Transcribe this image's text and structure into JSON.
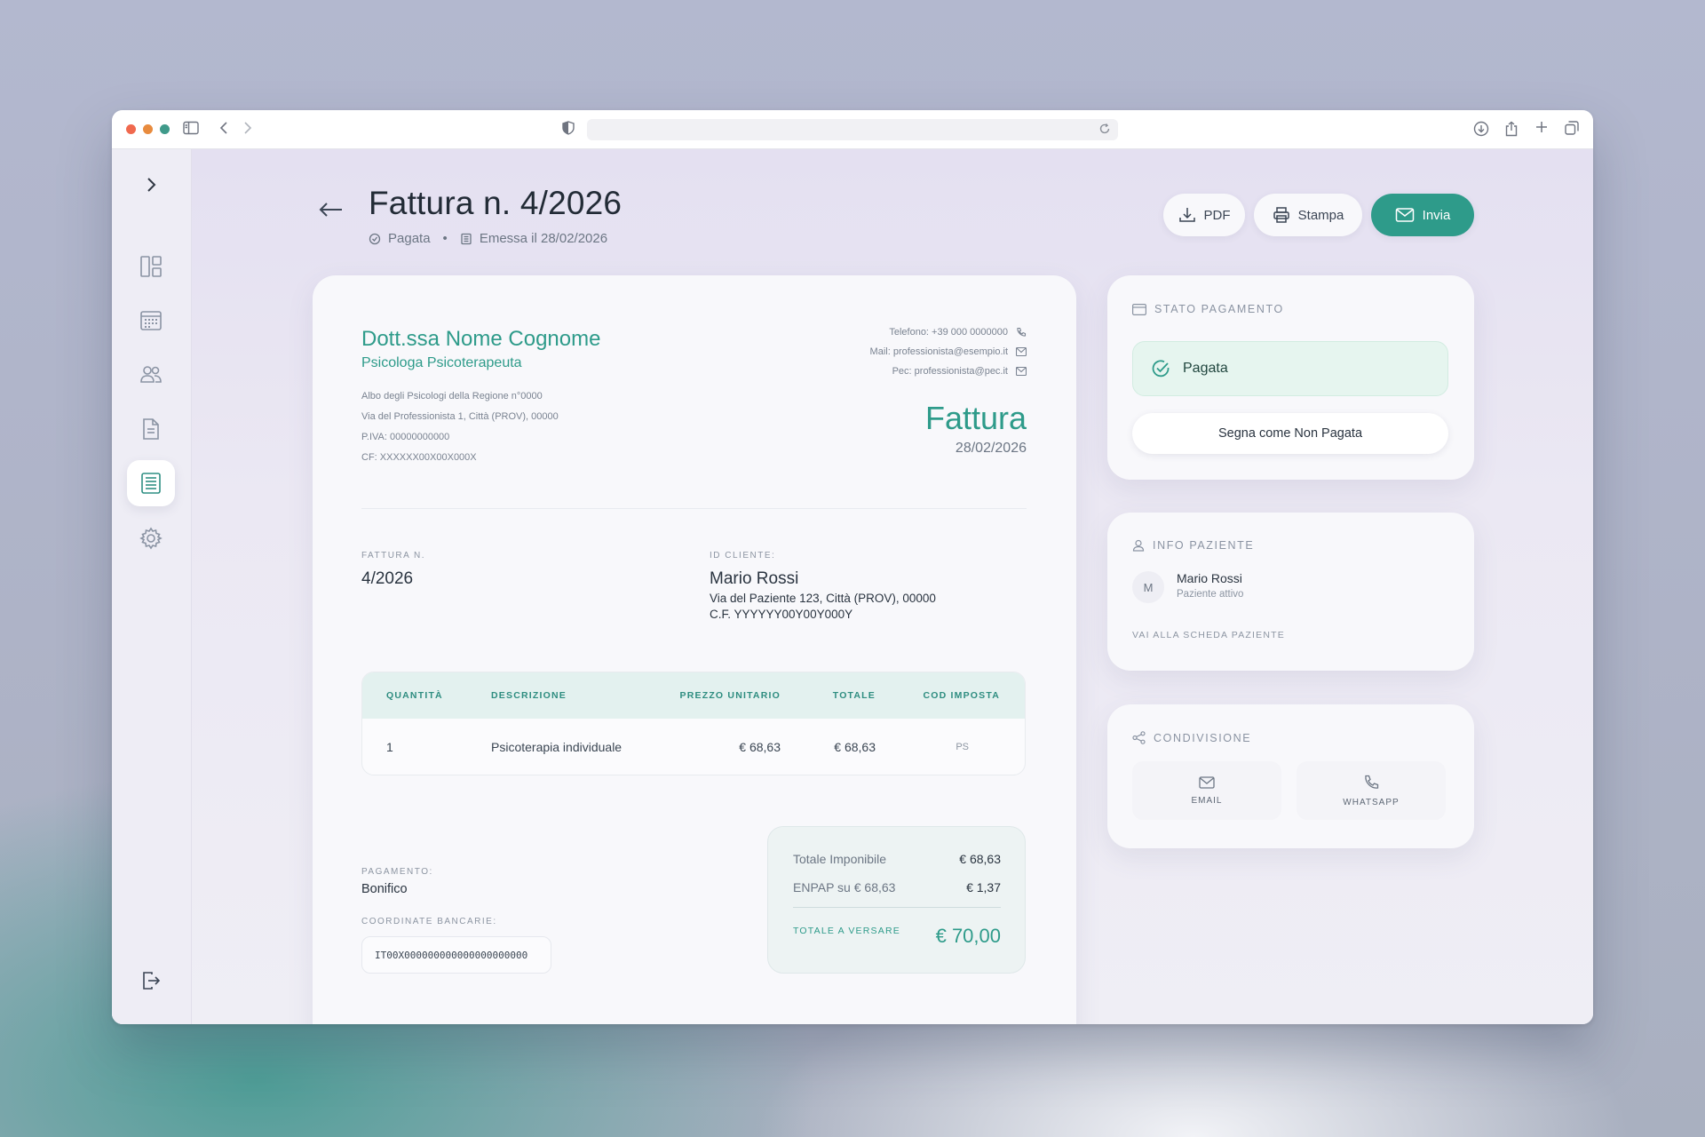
{
  "header": {
    "title": "Fattura n. 4/2026",
    "status": "Pagata",
    "separator": "•",
    "issued": "Emessa il 28/02/2026"
  },
  "actions": {
    "pdf": "PDF",
    "print": "Stampa",
    "send": "Invia"
  },
  "invoice": {
    "professional_name": "Dott.ssa Nome Cognome",
    "professional_role": "Psicologa Psicoterapeuta",
    "details": [
      "Albo degli Psicologi della Regione n°0000",
      "Via del Professionista 1, Città (PROV), 00000",
      "P.IVA: 00000000000",
      "CF: XXXXXX00X00X000X"
    ],
    "contacts": {
      "phone": "Telefono: +39 000 0000000",
      "mail": "Mail: professionista@esempio.it",
      "pec": "Pec: professionista@pec.it"
    },
    "doc_type": "Fattura",
    "doc_date": "28/02/2026",
    "number_label": "FATTURA N.",
    "number": "4/2026",
    "client_label": "ID CLIENTE:",
    "client_name": "Mario Rossi",
    "client_address": "Via del Paziente 123, Città (PROV), 00000",
    "client_cf": "C.F. YYYYYY00Y00Y000Y",
    "table": {
      "headers": [
        "QUANTITÀ",
        "DESCRIZIONE",
        "PREZZO UNITARIO",
        "TOTALE",
        "COD IMPOSTA"
      ],
      "rows": [
        {
          "qty": "1",
          "description": "Psicoterapia individuale",
          "unit_price": "€ 68,63",
          "total": "€ 68,63",
          "tax_code": "PS"
        }
      ]
    },
    "payment_label": "PAGAMENTO:",
    "payment_method": "Bonifico",
    "bank_label": "COORDINATE BANCARIE:",
    "iban": "IT00X000000000000000000000",
    "totals": {
      "taxable_label": "Totale Imponibile",
      "taxable_value": "€ 68,63",
      "enpap_label": "ENPAP su € 68,63",
      "enpap_value": "€ 1,37",
      "total_label": "TOTALE A VERSARE",
      "total_value": "€ 70,00"
    }
  },
  "payment_status": {
    "title": "STATO PAGAMENTO",
    "status": "Pagata",
    "toggle_button": "Segna come Non Pagata"
  },
  "patient_info": {
    "title": "INFO PAZIENTE",
    "avatar_initial": "M",
    "name": "Mario Rossi",
    "status": "Paziente attivo",
    "link": "VAI ALLA SCHEDA PAZIENTE"
  },
  "sharing": {
    "title": "CONDIVISIONE",
    "email": "EMAIL",
    "whatsapp": "WHATSAPP"
  },
  "colors": {
    "accent": "#2e9b8a",
    "paid_bg": "#e6f5ef"
  }
}
